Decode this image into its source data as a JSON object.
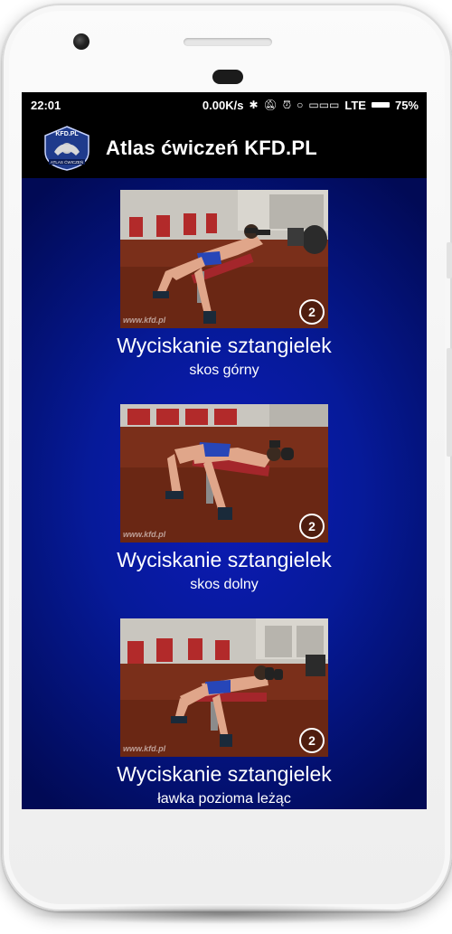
{
  "status_bar": {
    "time": "22:01",
    "network_speed": "0.00K/s",
    "icons": [
      "bluetooth-icon",
      "mute-bell-icon",
      "alarm-icon",
      "circle-icon",
      "signal-icon"
    ],
    "network_type": "LTE",
    "battery": "75%"
  },
  "app_bar": {
    "logo_text_top": "KFD.PL",
    "logo_text_bottom": "ATLAS ĆWICZEŃ",
    "title": "Atlas ćwiczeń KFD.PL"
  },
  "exercises": [
    {
      "title": "Wyciskanie sztangielek",
      "subtitle": "skos górny",
      "step": "2",
      "watermark": "www.kfd.pl"
    },
    {
      "title": "Wyciskanie sztangielek",
      "subtitle": "skos dolny",
      "step": "2",
      "watermark": "www.kfd.pl"
    },
    {
      "title": "Wyciskanie sztangielek",
      "subtitle": "ławka pozioma leżąc",
      "step": "2",
      "watermark": "www.kfd.pl"
    }
  ],
  "colors": {
    "background": "#061a99",
    "app_bar": "#000000",
    "text": "#ffffff"
  }
}
